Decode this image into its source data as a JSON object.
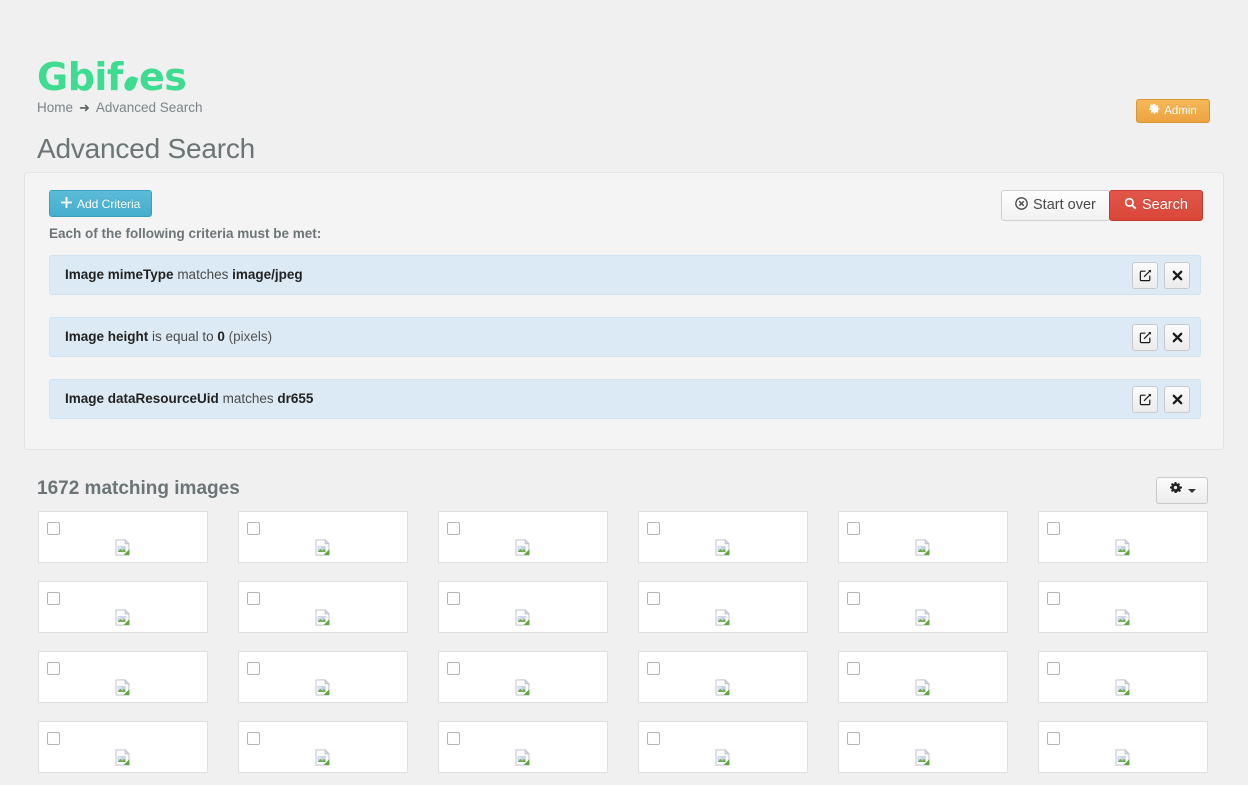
{
  "site": {
    "logo_text_1": "Gbif",
    "logo_text_2": "es",
    "logo_color": "#3ddc91"
  },
  "breadcrumb": {
    "home": "Home",
    "arrow": "➜",
    "current": "Advanced Search"
  },
  "admin": {
    "label": "Admin",
    "icon": "gear-icon",
    "color": "#eda33f"
  },
  "page": {
    "title": "Advanced Search"
  },
  "toolbar": {
    "add_criteria_label": "Add Criteria",
    "add_criteria_icon": "plus-icon",
    "start_over_label": "Start over",
    "start_over_icon": "circle-x-icon",
    "search_label": "Search",
    "search_icon": "magnifier-icon",
    "search_color": "#d94638"
  },
  "criteria": {
    "heading": "Each of the following criteria must be met:",
    "edit_icon": "edit-icon",
    "remove_icon": "x-icon",
    "rows": [
      {
        "field": "Image mimeType",
        "operator": "matches",
        "value": "image/jpeg",
        "units": ""
      },
      {
        "field": "Image height",
        "operator": "is equal to",
        "value": "0",
        "units": "(pixels)"
      },
      {
        "field": "Image dataResourceUid",
        "operator": "matches",
        "value": "dr655",
        "units": ""
      }
    ]
  },
  "results": {
    "count_label": "1672 matching images",
    "options_icon": "gear-icon",
    "options_caret": "chevron-down-icon",
    "image_placeholder": "broken-image-icon",
    "cards": [
      {
        "checked": false
      },
      {
        "checked": false
      },
      {
        "checked": false
      },
      {
        "checked": false
      },
      {
        "checked": false
      },
      {
        "checked": false
      },
      {
        "checked": false
      },
      {
        "checked": false
      },
      {
        "checked": false
      },
      {
        "checked": false
      },
      {
        "checked": false
      },
      {
        "checked": false
      },
      {
        "checked": false
      },
      {
        "checked": false
      },
      {
        "checked": false
      },
      {
        "checked": false
      },
      {
        "checked": false
      },
      {
        "checked": false
      },
      {
        "checked": false
      },
      {
        "checked": false
      },
      {
        "checked": false
      },
      {
        "checked": false
      },
      {
        "checked": false
      },
      {
        "checked": false
      }
    ]
  }
}
